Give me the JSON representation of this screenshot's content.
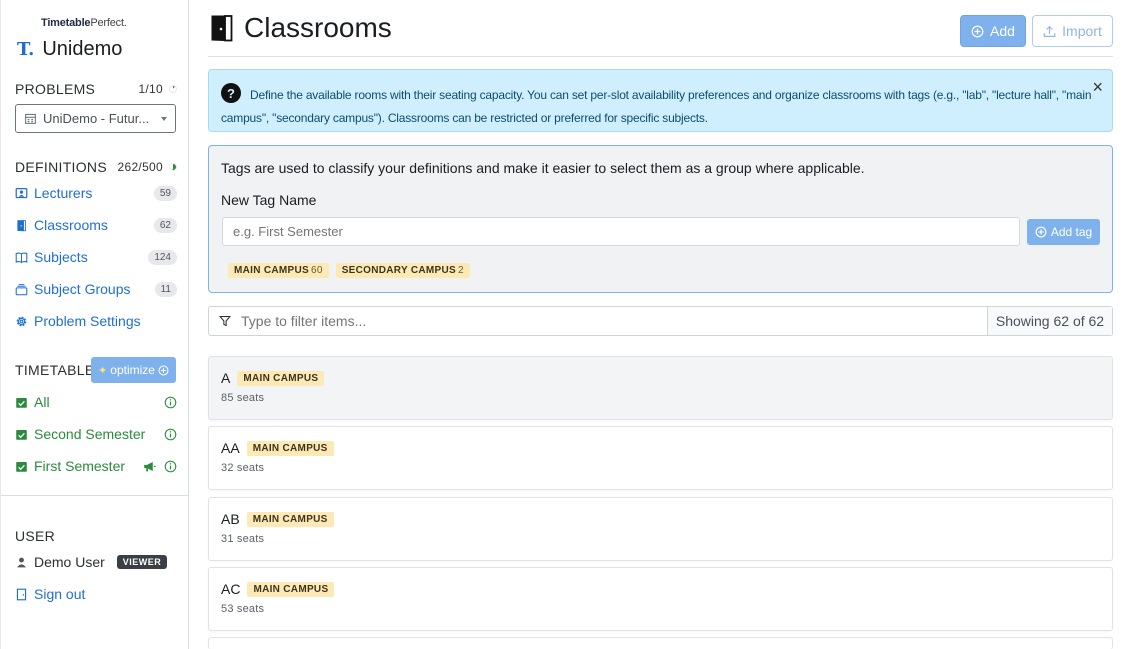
{
  "brand": {
    "small_bold": "Timetable",
    "small_rest": "Perfect.",
    "logo": "T.",
    "title": "Unidemo"
  },
  "problems": {
    "heading": "PROBLEMS",
    "count": "1/10",
    "selected": "UniDemo - Futur..."
  },
  "definitions": {
    "heading": "DEFINITIONS",
    "count": "262/500",
    "items": [
      {
        "label": "Lecturers",
        "count": "59"
      },
      {
        "label": "Classrooms",
        "count": "62"
      },
      {
        "label": "Subjects",
        "count": "124"
      },
      {
        "label": "Subject Groups",
        "count": "11"
      },
      {
        "label": "Problem Settings"
      }
    ]
  },
  "timetables": {
    "heading": "TIMETABLES",
    "optimize_label": "optimize",
    "items": [
      {
        "label": "All"
      },
      {
        "label": "Second Semester"
      },
      {
        "label": "First Semester"
      }
    ]
  },
  "user": {
    "heading": "USER",
    "name": "Demo User",
    "role": "VIEWER",
    "sign_out": "Sign out"
  },
  "page": {
    "title": "Classrooms",
    "add_label": "Add",
    "import_label": "Import",
    "info": "Define the available rooms with their seating capacity. You can set per-slot availability preferences and organize classrooms with tags (e.g., \"lab\", \"lecture hall\", \"main campus\", \"secondary campus\"). Classrooms can be restricted or preferred for specific subjects.",
    "close_symbol": "×"
  },
  "tags": {
    "description": "Tags are used to classify your definitions and make it easier to select them as a group where applicable.",
    "new_tag_label": "New Tag Name",
    "placeholder": "e.g. First Semester",
    "add_tag_label": "Add tag",
    "chips": [
      {
        "name": "MAIN CAMPUS",
        "count": "60"
      },
      {
        "name": "SECONDARY CAMPUS",
        "count": "2"
      }
    ]
  },
  "filter": {
    "placeholder": "Type to filter items...",
    "showing": "Showing 62 of 62"
  },
  "rooms": [
    {
      "name": "A",
      "tag": "MAIN CAMPUS",
      "seats": "85 seats"
    },
    {
      "name": "AA",
      "tag": "MAIN CAMPUS",
      "seats": "32 seats"
    },
    {
      "name": "AB",
      "tag": "MAIN CAMPUS",
      "seats": "31 seats"
    },
    {
      "name": "AC",
      "tag": "MAIN CAMPUS",
      "seats": "53 seats"
    }
  ],
  "colors": {
    "primary": "#1f6fd1",
    "primary_light": "#7fb2ec",
    "success": "#2a8a3e",
    "info_bg": "#cfefff",
    "tag_bg": "#fce9b5"
  }
}
